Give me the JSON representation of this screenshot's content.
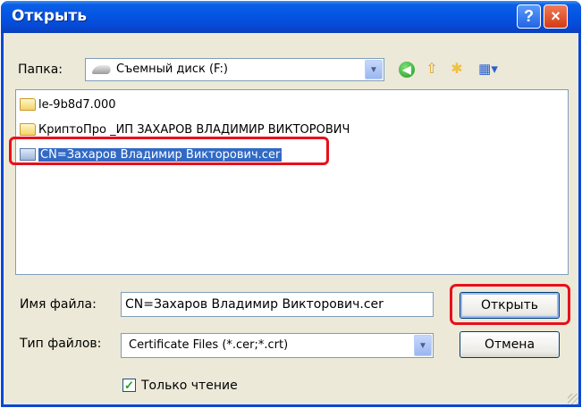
{
  "window": {
    "title": "Открыть"
  },
  "titlebar": {
    "help_glyph": "?",
    "close_glyph": "×"
  },
  "folder": {
    "label": "Папка:",
    "value": "Съемный диск (F:)"
  },
  "toolbar": {
    "back_icon": "back-arrow-icon",
    "up_icon": "up-folder-icon",
    "new_folder_icon": "new-folder-icon",
    "views_icon": "views-menu-icon"
  },
  "files": [
    {
      "name": "le-9b8d7.000",
      "type": "folder"
    },
    {
      "name": "КриптоПро _ИП ЗАХАРОВ ВЛАДИМИР ВИКТОРОВИЧ",
      "type": "folder"
    },
    {
      "name": "CN=Захаров Владимир Викторович.cer",
      "type": "certificate",
      "selected": true
    }
  ],
  "filename": {
    "label": "Имя файла:",
    "value": "CN=Захаров Владимир Викторович.cer"
  },
  "filetype": {
    "label": "Тип файлов:",
    "value": "Certificate Files (*.cer;*.crt)"
  },
  "buttons": {
    "open": "Открыть",
    "cancel": "Отмена"
  },
  "readonly": {
    "label": "Только чтение",
    "checked": true
  },
  "colors": {
    "titlebar": "#0554e3",
    "selection": "#316ac5",
    "highlight": "#e8101b"
  }
}
